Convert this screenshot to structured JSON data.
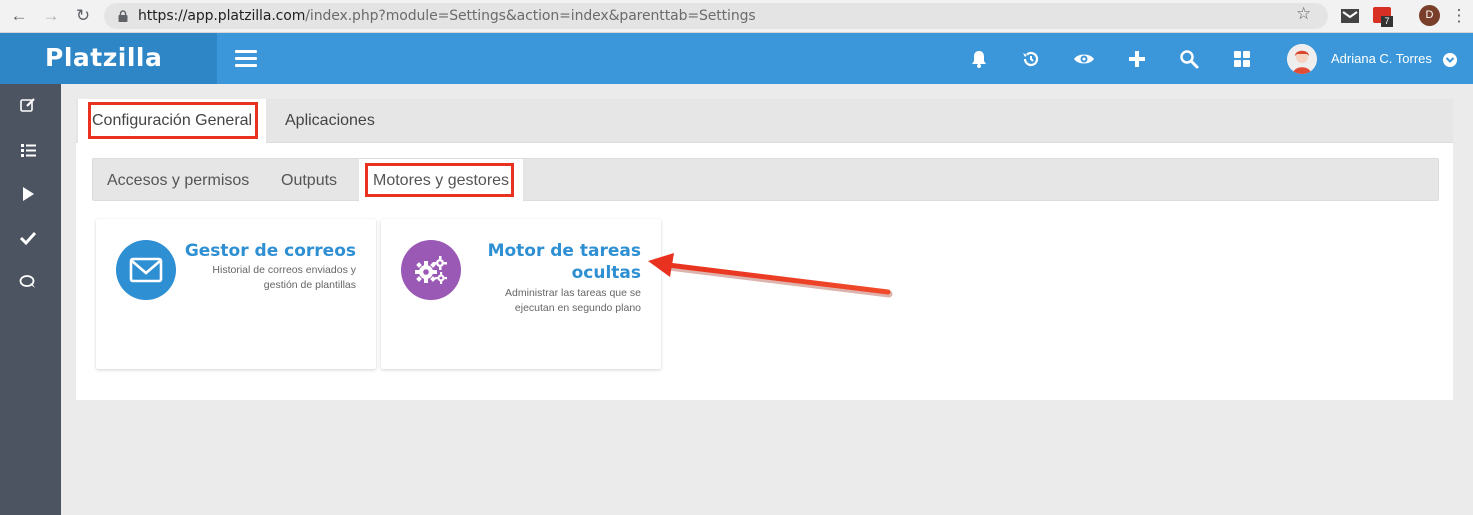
{
  "browser": {
    "url_host": "https://app.platzilla.com",
    "url_path": "/index.php?module=Settings&action=index&parenttab=Settings",
    "ext_badge": "7",
    "profile_initial": "D"
  },
  "header": {
    "brand": "Platzilla",
    "user_name": "Adriana C. Torres",
    "icons": [
      "bell-icon",
      "history-icon",
      "eye-icon",
      "plus-icon",
      "search-icon",
      "grid-icon"
    ]
  },
  "sidebar": {
    "items": [
      "edit-icon",
      "list-icon",
      "play-icon",
      "check-icon",
      "chat-icon"
    ]
  },
  "tabs_primary": [
    {
      "label": "Configuración General",
      "active": true
    },
    {
      "label": "Aplicaciones",
      "active": false
    }
  ],
  "tabs_secondary": [
    {
      "label": "Accesos y permisos",
      "active": false
    },
    {
      "label": "Outputs",
      "active": false
    },
    {
      "label": "Motores y gestores",
      "active": true
    }
  ],
  "cards": [
    {
      "title": "Gestor de correos",
      "description_line1": "Historial de correos enviados y",
      "description_line2": "gestión de plantillas",
      "icon": "envelope-icon",
      "color": "#2e8fd3"
    },
    {
      "title_line1": "Motor de tareas",
      "title_line2": "ocultas",
      "description_line1": "Administrar las tareas que se",
      "description_line2": "ejecutan en segundo plano",
      "icon": "gears-icon",
      "color": "#9b59b6"
    }
  ],
  "colors": {
    "header": "#3b97d9",
    "brand_bg": "#2f86c6",
    "sidebar": "#4d5461",
    "highlight": "#e8321f"
  }
}
